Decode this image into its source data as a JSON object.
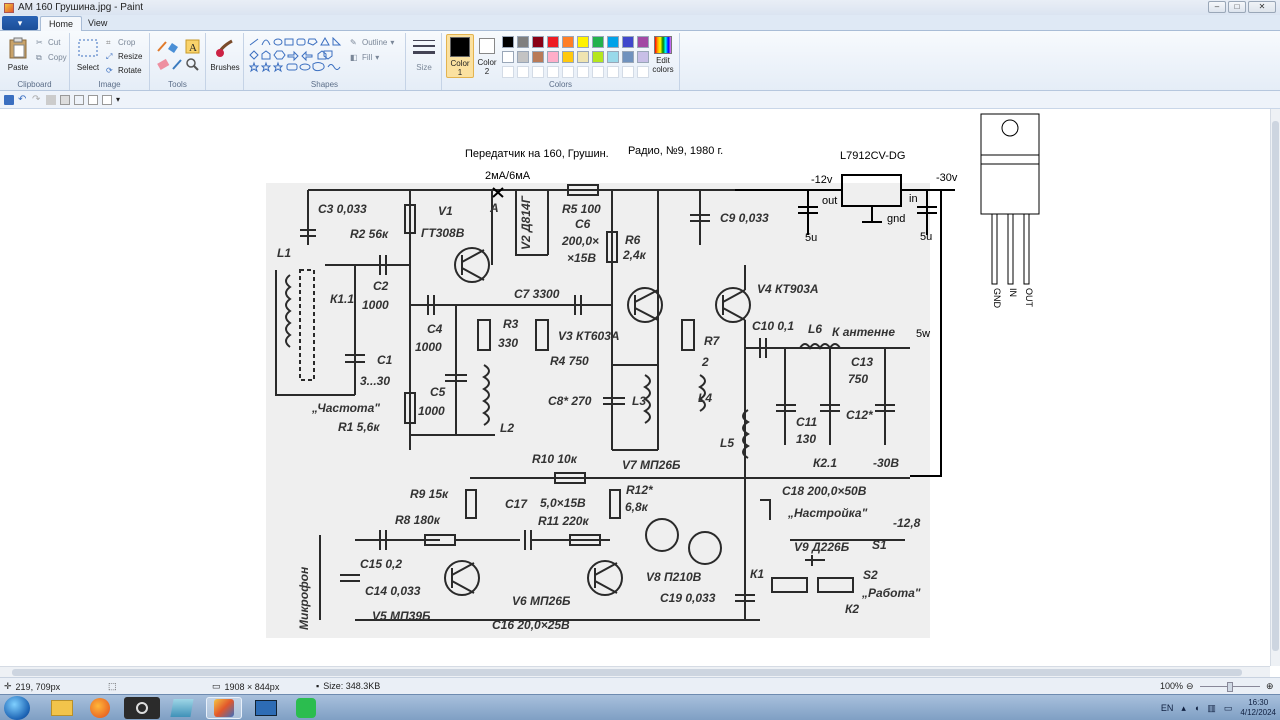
{
  "window": {
    "title": "AM 160 Грушина.jpg - Paint"
  },
  "tabs": {
    "file": "▾",
    "home": "Home",
    "view": "View"
  },
  "ribbon": {
    "clipboard": {
      "paste": "Paste",
      "cut": "Cut",
      "copy": "Copy",
      "label": "Clipboard"
    },
    "image": {
      "select": "Select",
      "crop": "Crop",
      "resize": "Resize",
      "rotate": "Rotate",
      "label": "Image"
    },
    "tools": {
      "label": "Tools"
    },
    "brushes": {
      "label": "Brushes"
    },
    "shapes": {
      "outline": "Outline",
      "fill": "Fill",
      "label": "Shapes"
    },
    "size": {
      "label": "Size"
    },
    "colors": {
      "color1": "Color\n1",
      "color1_a": "Color",
      "color1_b": "1",
      "color2_a": "Color",
      "color2_b": "2",
      "edit": "Edit colors",
      "edit_a": "Edit",
      "edit_b": "colors",
      "label": "Colors",
      "palette": [
        "#000000",
        "#7f7f7f",
        "#880015",
        "#ed1c24",
        "#ff7f27",
        "#fff200",
        "#22b14c",
        "#00a2e8",
        "#3f48cc",
        "#a349a4",
        "#ffffff",
        "#c3c3c3",
        "#b97a57",
        "#ffaec9",
        "#ffc90e",
        "#efe4b0",
        "#b5e61d",
        "#99d9ea",
        "#7092be",
        "#c8bfe7",
        "#ffffff",
        "#ffffff",
        "#ffffff",
        "#ffffff",
        "#ffffff",
        "#ffffff",
        "#ffffff",
        "#ffffff",
        "#ffffff",
        "#ffffff"
      ]
    }
  },
  "schematic": {
    "title": "Передатчик на 160, Грушин.",
    "source": "Радио, №9, 1980 г.",
    "current": "2мА/6мА",
    "regulator": "L7912CV-DG",
    "v_minus12": "-12v",
    "v_minus30": "-30v",
    "out": "out",
    "in": "in",
    "gnd": "gnd",
    "cap_left": "5u",
    "cap_right": "5u",
    "power_out": "5w",
    "pins": [
      "GND",
      "IN",
      "OUT"
    ],
    "labels": {
      "c3": "C3 0,033",
      "l1": "L1",
      "r2": "R2 56к",
      "v1": "V1",
      "v1_type": "ГТ308В",
      "a": "A",
      "v2": "V2 Д814Г",
      "r5": "R5 100",
      "c6": "C6",
      "c6v": "200,0×",
      "c6b": "×15В",
      "c9": "C9 0,033",
      "r6": "R6",
      "r6v": "2,4к",
      "c2": "C2",
      "c2v": "1000",
      "k11": "К1.1",
      "c1": "C1",
      "c1v": "3...30",
      "c4": "C4",
      "c4v": "1000",
      "r3": "R3",
      "r3v": "330",
      "c7": "C7 3300",
      "v3": "V3 КТ603А",
      "r4": "R4 750",
      "v4": "V4 КТ903А",
      "r7": "R7",
      "r7v": "2",
      "c10": "C10 0,1",
      "l6": "L6",
      "kant": "К антенне",
      "c13": "C13",
      "c13v": "750",
      "chast": "„Частота\"",
      "r1": "R1 5,6к",
      "c5": "C5",
      "c5v": "1000",
      "l2": "L2",
      "c8": "C8* 270",
      "l3": "L3",
      "l4": "L4",
      "c11": "C11",
      "c11v": "130",
      "c12": "C12*",
      "l5": "L5",
      "k21": "К2.1",
      "m30": "-30В",
      "r10": "R10 10к",
      "v7": "V7 МП26Б",
      "r9": "R9 15к",
      "c17": "C17",
      "c17v": "5,0×15В",
      "r12": "R12*",
      "r12v": "6,8к",
      "c18": "C18 200,0×50В",
      "nastr": "„Настройка\"",
      "r8": "R8 180к",
      "r11": "R11 220к",
      "m12": "-12,8",
      "c15": "C15 0,2",
      "c14": "C14 0,033",
      "v6": "V6 МП26Б",
      "v8": "V8 П210В",
      "v9": "V9 Д226Б",
      "s1": "S1",
      "s2": "S2",
      "rabota": "„Работа\"",
      "k1": "К1",
      "c19": "C19 0,033",
      "k2": "К2",
      "mic": "Микрофон",
      "v5": "V5 МП39Б",
      "c16": "C16 20,0×25В"
    }
  },
  "status": {
    "cursor": "219, 709px",
    "selection": "",
    "dimensions": "1908 × 844px",
    "size": "Size: 348.3KB",
    "zoom": "100%"
  },
  "tray": {
    "lang": "EN",
    "time": "16:30",
    "date": "4/12/2024"
  }
}
